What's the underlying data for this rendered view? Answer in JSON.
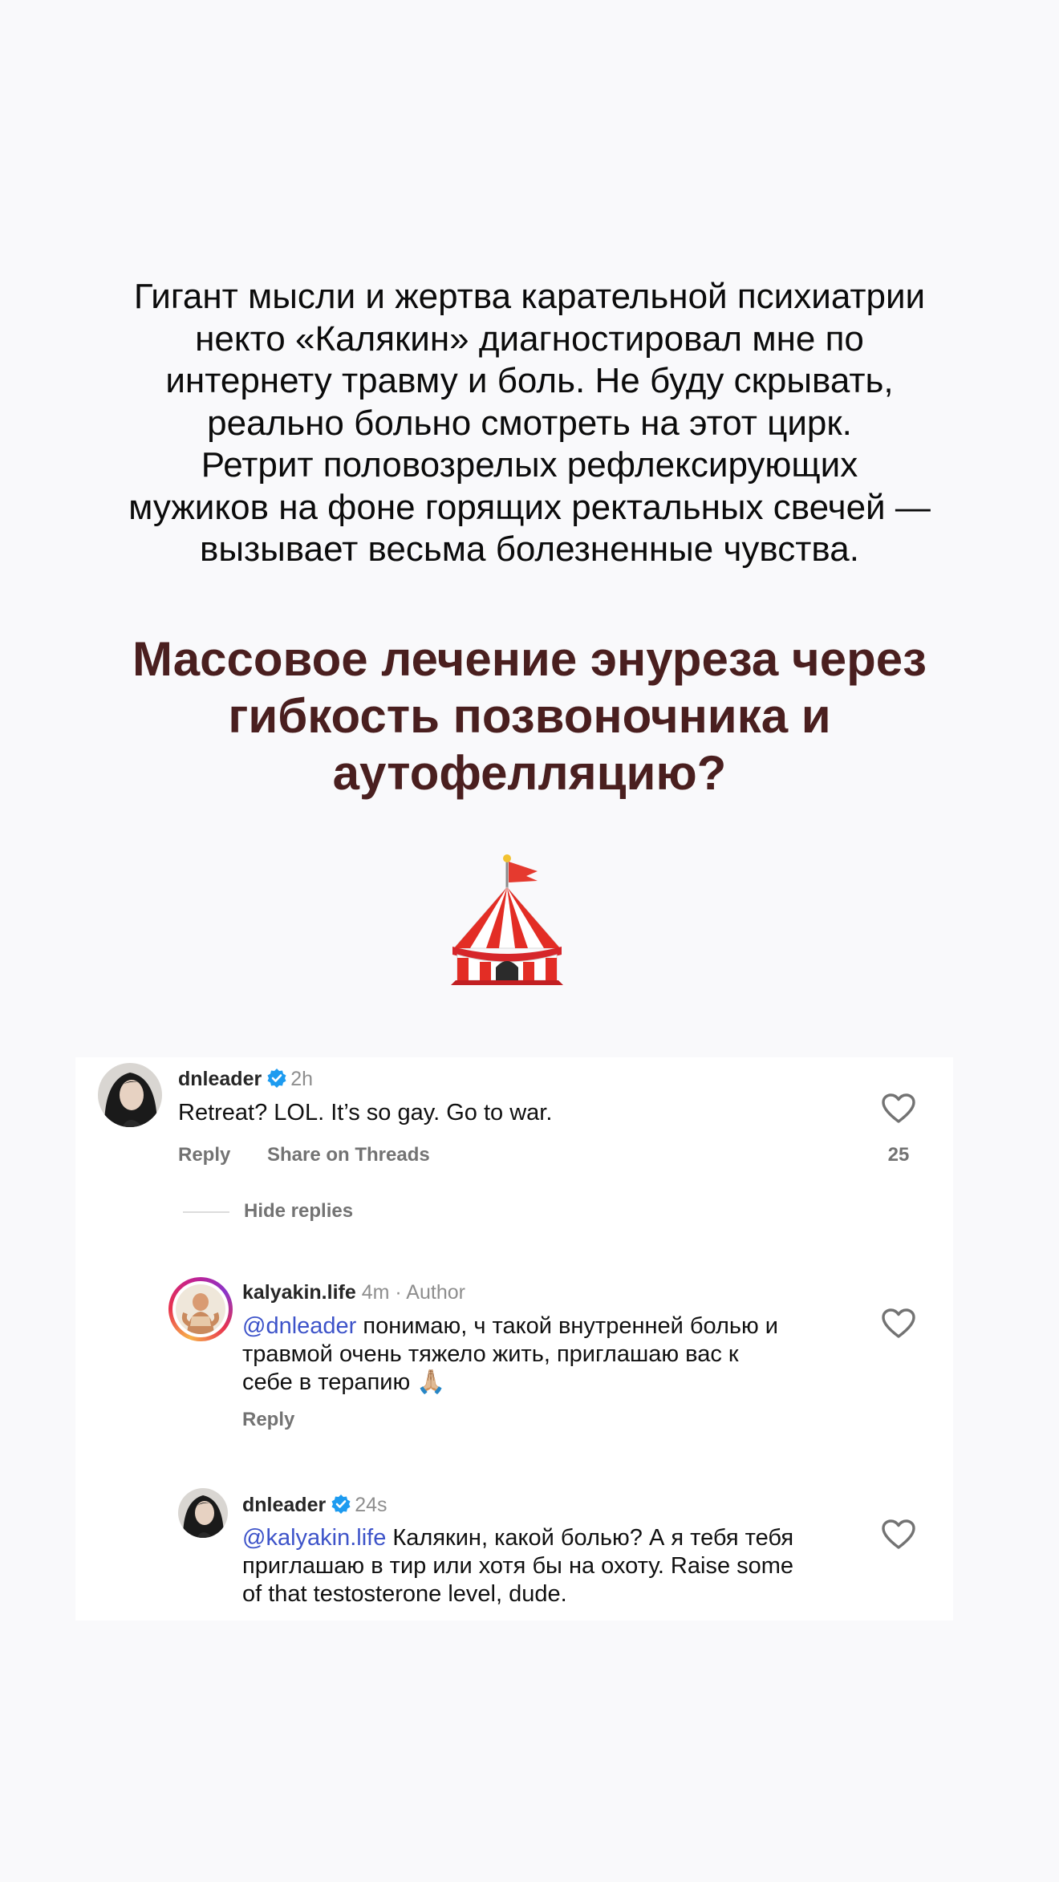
{
  "intro_lines": [
    "Гигант мысли и жертва карательной психиатрии",
    "некто «Калякин» диагностировал мне по",
    "интернету травму и боль. Не буду скрывать,",
    "реально больно смотреть на этот цирк.",
    "Ретрит половозрелых рефлексирующих",
    "мужиков на фоне горящих ректальных свечей —",
    "вызывает весьма болезненные чувства."
  ],
  "headline_lines": [
    "Массовое лечение энуреза через",
    "гибкость позвоночника и",
    "аутофелляцию?"
  ],
  "emoji": {
    "icon": "circus-tent-icon"
  },
  "colors": {
    "background": "#f9f9fb",
    "headline": "#4a1f1f",
    "mention": "#3d53c9",
    "verified": "#1d9bf0",
    "muted": "#737373"
  },
  "comments": {
    "top": {
      "username": "dnleader",
      "verified": true,
      "time": "2h",
      "text": "Retreat? LOL. It’s so gay. Go to war.",
      "reply_label": "Reply",
      "threads_label": "Share on Threads",
      "likes": "25"
    },
    "hide_replies_label": "Hide replies",
    "replies": [
      {
        "username": "kalyakin.life",
        "time": "4m",
        "separator": "·",
        "tag": "Author",
        "mention": "@dnleader",
        "text_lines": [
          " понимаю, ч такой внутренней болью и",
          "травмой очень тяжело жить, приглашаю вас к",
          "себе в терапию 🙏🏼"
        ],
        "reply_label": "Reply"
      },
      {
        "username": "dnleader",
        "verified": true,
        "time": "24s",
        "mention": "@kalyakin.life",
        "text_lines": [
          " Калякин, какой болью? А я тебя тебя",
          "приглашаю в тир или хотя бы на охоту. Raise some",
          "of that testosterone level, dude."
        ]
      }
    ]
  }
}
